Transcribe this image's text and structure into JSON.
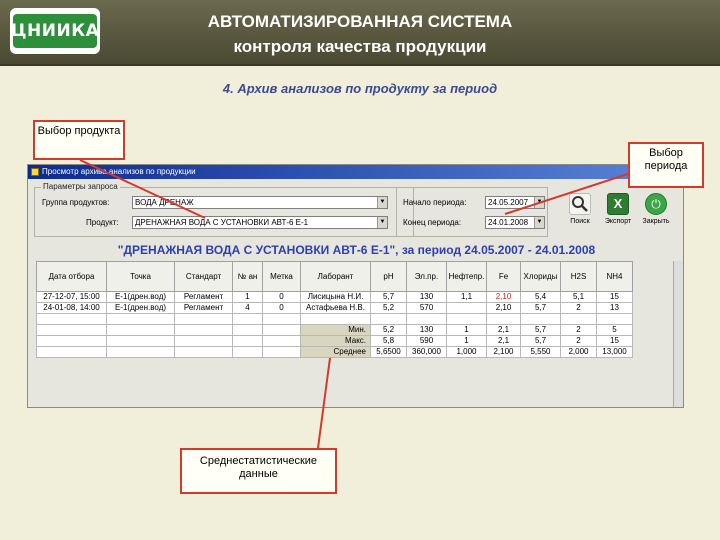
{
  "header": {
    "logo_text": "ЦНИИКА",
    "title_line1": "АВТОМАТИЗИРОВАННАЯ СИСТЕМА",
    "title_line2": "контроля качества продукции"
  },
  "subtitle": "4. Архив анализов по продукту за период",
  "callouts": {
    "product": "Выбор продукта",
    "period": "Выбор периода",
    "stats": "Среднестатистические данные"
  },
  "window": {
    "title": "Просмотр архива анализов по продукции",
    "params_legend": "Параметры запроса",
    "group_label": "Группа продуктов:",
    "group_value": "ВОДА ДРЕНАЖ",
    "product_label": "Продукт:",
    "product_value": "ДРЕНАЖНАЯ ВОДА С УСТАНОВКИ АВТ-6 Е-1",
    "start_label": "Начало периода:",
    "start_value": "24.05.2007",
    "end_label": "Конец периода:",
    "end_value": "24.01.2008",
    "buttons": {
      "search": "Поиск",
      "export": "Экспорт",
      "close": "Закрыть"
    },
    "selection_title": "\"ДРЕНАЖНАЯ ВОДА С УСТАНОВКИ АВТ-6 Е-1\", за период 24.05.2007 - 24.01.2008"
  },
  "table": {
    "headers": [
      "Дата отбора",
      "Точка",
      "Стандарт",
      "№ ан",
      "Метка",
      "Лаборант",
      "pH",
      "Эл.пр.",
      "Нефтепр.",
      "Fe",
      "Хлориды",
      "H2S",
      "NH4"
    ],
    "rows": [
      [
        "27-12-07, 15:00",
        "Е-1(дрен.вод)",
        "Регламент",
        "1",
        "0",
        "Лисицына Н.И.",
        "5,7",
        "130",
        "1,1",
        "2,10",
        "5,4",
        "5,1",
        "15"
      ],
      [
        "24-01-08, 14:00",
        "Е-1(дрен.вод)",
        "Регламент",
        "4",
        "0",
        "Астафьева Н.В.",
        "5,2",
        "570",
        "",
        "2,10",
        "5,7",
        "2",
        "13"
      ]
    ],
    "stats": [
      {
        "label": "Мин.",
        "values": [
          "5,2",
          "130",
          "1",
          "2,1",
          "5,7",
          "2",
          "5"
        ]
      },
      {
        "label": "Макс.",
        "values": [
          "5,8",
          "590",
          "1",
          "2,1",
          "5,7",
          "2",
          "15"
        ]
      },
      {
        "label": "Среднее",
        "values": [
          "5,6500",
          "360,000",
          "1,000",
          "2,100",
          "5,550",
          "2,000",
          "13,000"
        ]
      }
    ]
  },
  "colors": {
    "header_bg": "#5a5940",
    "accent_red": "#d5392b",
    "title_blue": "#2d3fae"
  }
}
